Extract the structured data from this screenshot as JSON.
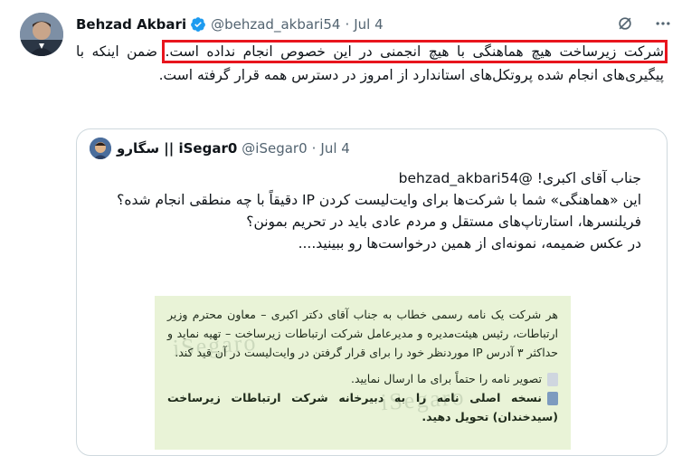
{
  "author": {
    "name": "Behzad Akbari",
    "handle": "@behzad_akbari54",
    "separator": "·",
    "date": "Jul 4"
  },
  "tweet": {
    "highlighted": "شرکت زیرساخت هیچ هماهنگی با هیچ انجمنی در این خصوص انجام نداده است.",
    "rest": " ضمن اینکه با پیگیری‌های انجام شده پروتکل‌های استاندارد از امروز در دسترس همه قرار گرفته است."
  },
  "quoted": {
    "name": "سگارو || iSegar0",
    "handle": "@iSegar0",
    "separator": "·",
    "date": "Jul 4",
    "lines": [
      "جناب آقای اکبری! @behzad_akbari54",
      "این «هماهنگی» شما با شرکت‌ها برای وایت‌لیست کردن IP دقیقاً با چه منطقی انجام شده؟",
      "فریلنسرها، استارتاپ‌های مستقل و مردم عادی باید در تحریم بمونن؟",
      "در عکس ضمیمه، نمونه‌ای از همین درخواست‌ها رو ببینید...."
    ],
    "media": {
      "p1": "هر شرکت یک نامه رسمی خطاب به جناب آقای دکتر اکبری – معاون محترم وزیر ارتباطات، رئیس هیئت‌مدیره و مدیرعامل شرکت ارتباطات زیرساخت – تهیه نماید و حداکثر ۳ آدرس IP موردنظر خود را برای قرار گرفتن در وایت‌لیست در آن قید کند.",
      "p2": "تصویر نامه را حتماً برای ما ارسال نمایید.",
      "p3": "نسخه اصلی نامه را به دبیرخانه شرکت ارتباطات زیرساخت (سیدخندان) تحویل دهید.",
      "watermark": "iSegaro"
    }
  },
  "icons": {
    "verified": "verified-badge-icon",
    "grok": "grok-icon",
    "more": "more-icon"
  },
  "colors": {
    "highlight": "#e8151d",
    "verified": "#1d9bf0"
  }
}
